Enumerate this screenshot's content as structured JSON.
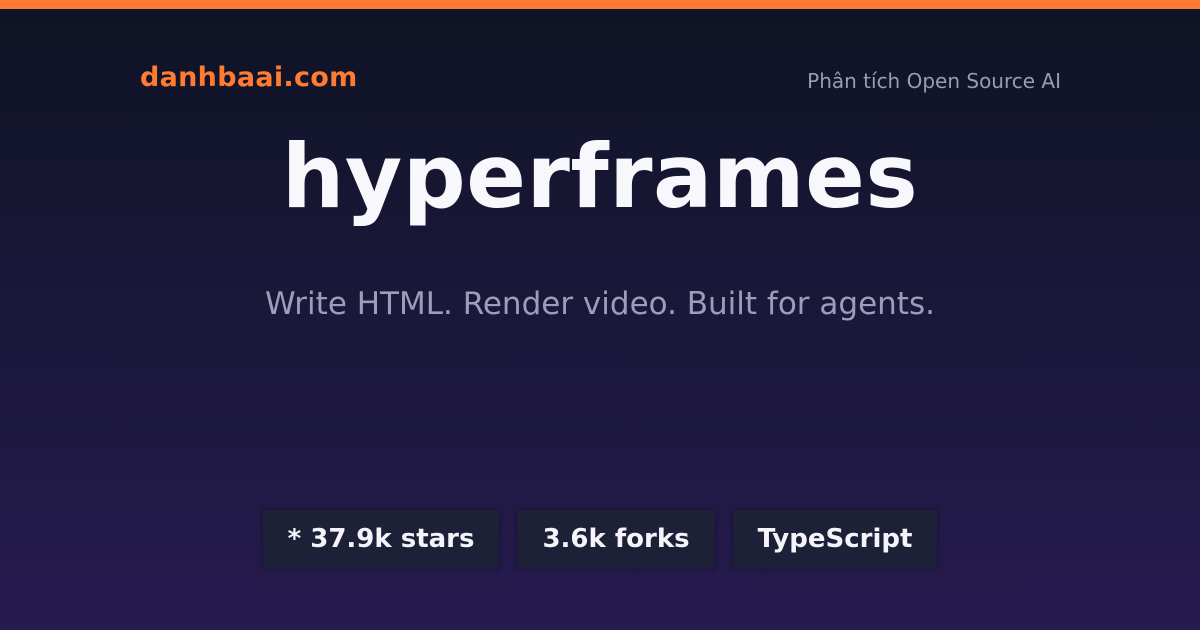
{
  "brand": {
    "name": "danhbaai.com",
    "color": "#ff7b32"
  },
  "header": {
    "tagline": "Phân tích Open Source AI"
  },
  "repo": {
    "title": "hyperframes",
    "description": "Write HTML. Render video. Built for agents."
  },
  "badges": [
    {
      "label": "* 37.9k stars"
    },
    {
      "label": "3.6k forks"
    },
    {
      "label": "TypeScript"
    }
  ],
  "colors": {
    "accent": "#ff7b32",
    "background_top": "#0e1324",
    "background_bottom": "#261b50",
    "badge_background": "#1c2138"
  }
}
